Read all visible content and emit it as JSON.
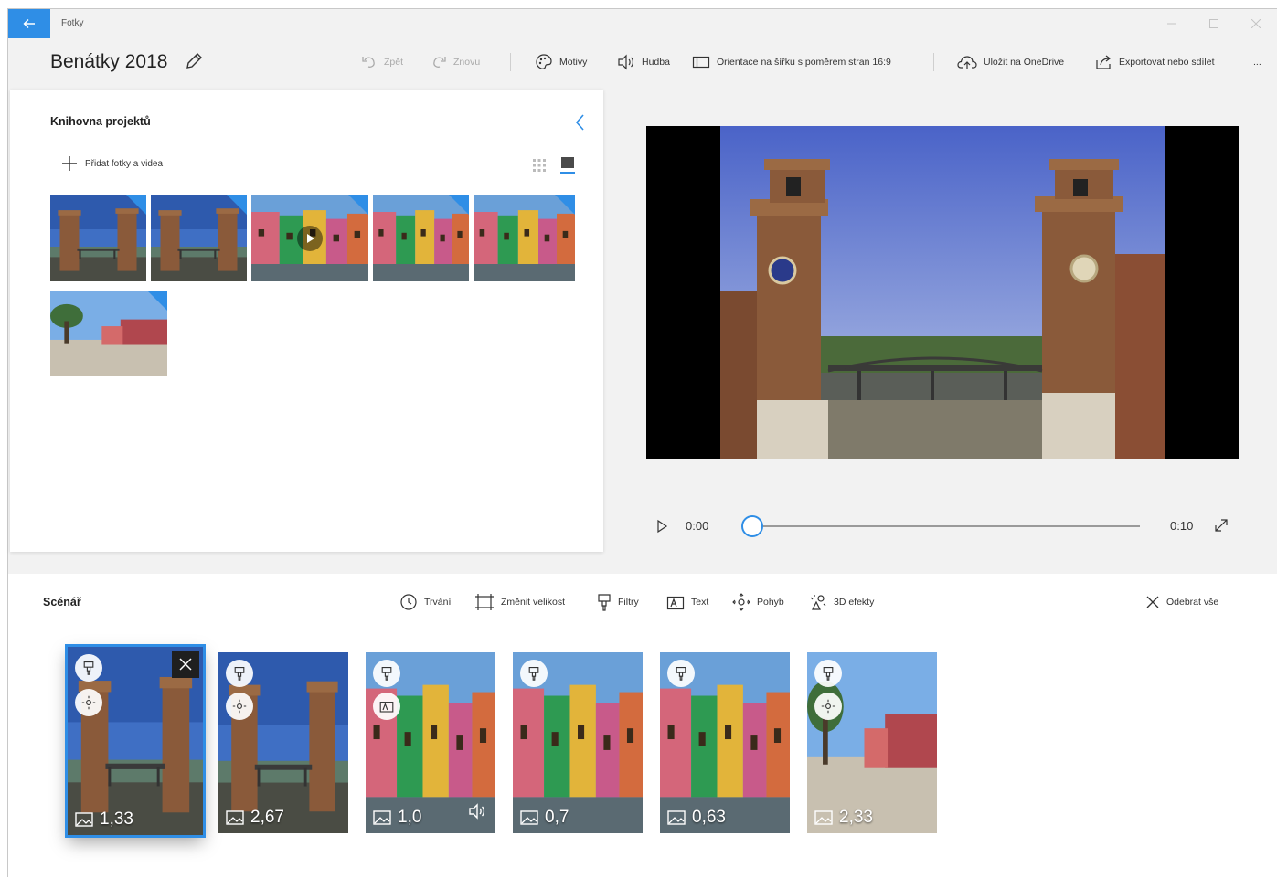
{
  "app": {
    "name": "Fotky"
  },
  "project": {
    "title": "Benátky 2018"
  },
  "toolbar": {
    "undo": "Zpět",
    "redo": "Znovu",
    "themes": "Motivy",
    "music": "Hudba",
    "aspect": "Orientace na šířku s poměrem stran 16:9",
    "onedrive": "Uložit na OneDrive",
    "export": "Exportovat nebo sdílet",
    "more": "..."
  },
  "library": {
    "title": "Knihovna projektů",
    "add_label": "Přidat fotky a videa"
  },
  "player": {
    "current_time": "0:00",
    "total_time": "0:10",
    "progress": 0.0
  },
  "storyboard": {
    "title": "Scénář",
    "tools": {
      "duration": "Trvání",
      "resize": "Změnit velikost",
      "filters": "Filtry",
      "text": "Text",
      "motion": "Pohyb",
      "effects3d": "3D efekty"
    },
    "remove_all": "Odebrat vše",
    "clips": [
      {
        "duration": "1,33",
        "selected": true
      },
      {
        "duration": "2,67",
        "selected": false
      },
      {
        "duration": "1,0",
        "selected": false
      },
      {
        "duration": "0,7",
        "selected": false
      },
      {
        "duration": "0,63",
        "selected": false
      },
      {
        "duration": "2,33",
        "selected": false
      }
    ]
  },
  "colors": {
    "accent": "#2f8ee6"
  }
}
